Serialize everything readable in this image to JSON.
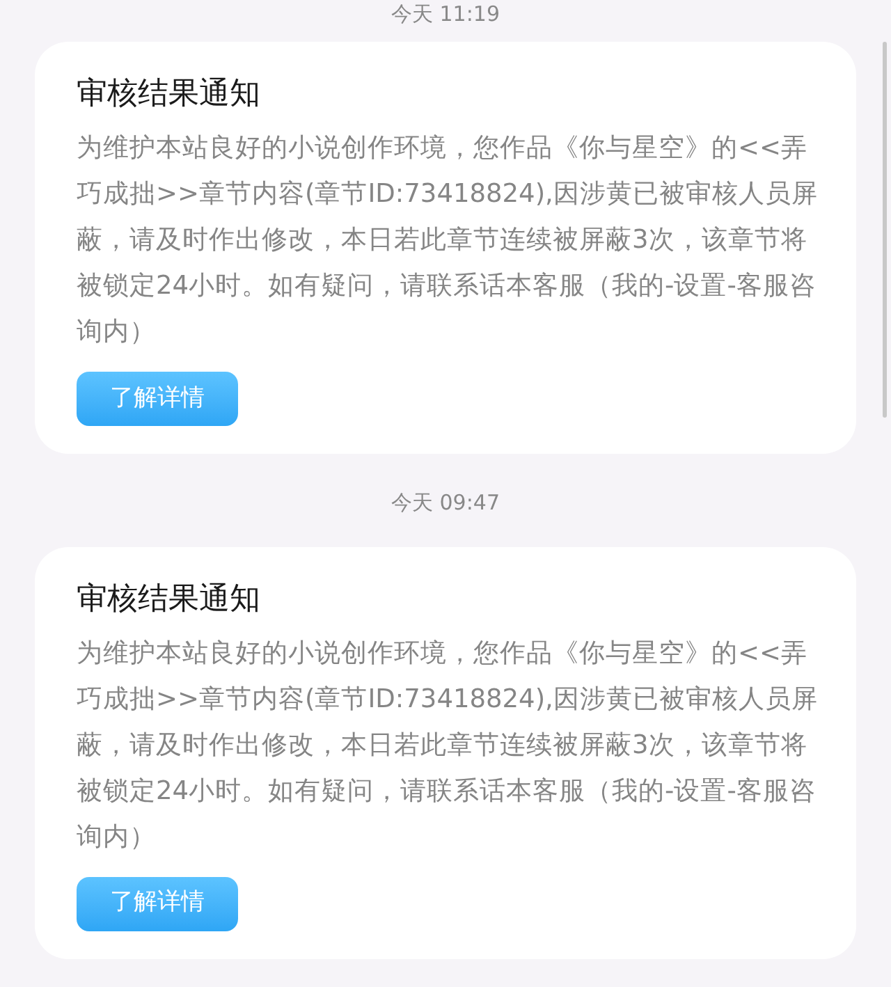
{
  "messages": [
    {
      "time": "今天 11:19",
      "title": "审核结果通知",
      "body": "为维护本站良好的小说创作环境，您作品《你与星空》的<<弄巧成拙>>章节内容(章节ID:73418824),因涉黄已被审核人员屏蔽，请及时作出修改，本日若此章节连续被屏蔽3次，该章节将被锁定24小时。如有疑问，请联系话本客服（我的-设置-客服咨询内）",
      "button": "了解详情"
    },
    {
      "time": "今天 09:47",
      "title": "审核结果通知",
      "body": "为维护本站良好的小说创作环境，您作品《你与星空》的<<弄巧成拙>>章节内容(章节ID:73418824),因涉黄已被审核人员屏蔽，请及时作出修改，本日若此章节连续被屏蔽3次，该章节将被锁定24小时。如有疑问，请联系话本客服（我的-设置-客服咨询内）",
      "button": "了解详情"
    }
  ]
}
